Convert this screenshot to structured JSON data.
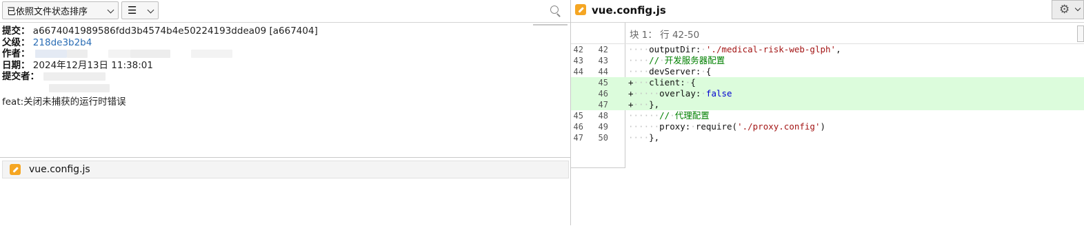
{
  "toolbar": {
    "sort_label": "已依照文件状态排序",
    "view_icon": "list-icon",
    "search_icon": "search-icon"
  },
  "commit": {
    "commit_label": "提交：",
    "commit_hash": "a6674041989586fdd3b4574b4e50224193ddea09 [a667404]",
    "parent_label": "父级：",
    "parent_hash": "218de3b2b4",
    "author_label": "作者：",
    "date_label": "日期：",
    "date_value": "2024年12月13日 11:38:01",
    "committer_label": "提交者：",
    "message": "feat:关闭未捕获的运行时错误"
  },
  "files": [
    {
      "name": "vue.config.js",
      "status_icon": "pencil-icon"
    }
  ],
  "diff": {
    "file_name": "vue.config.js",
    "settings_icon": "gear-icon",
    "hunk_header": "块 1： 行 42-50",
    "lines": [
      {
        "old": "42",
        "new": "42",
        "type": "ctx",
        "ws": "····",
        "tokens": [
          {
            "t": "outputDir:",
            "c": "k"
          },
          {
            "t": "·",
            "c": "ws"
          },
          {
            "t": "'./medical-risk-web-glph'",
            "c": "s"
          },
          {
            "t": ",",
            "c": "k"
          }
        ]
      },
      {
        "old": "43",
        "new": "43",
        "type": "ctx",
        "ws": "····",
        "tokens": [
          {
            "t": "//",
            "c": "c"
          },
          {
            "t": "·",
            "c": "ws"
          },
          {
            "t": "开发服务器配置",
            "c": "c"
          }
        ]
      },
      {
        "old": "44",
        "new": "44",
        "type": "ctx",
        "ws": "····",
        "tokens": [
          {
            "t": "devServer:",
            "c": "k"
          },
          {
            "t": "·",
            "c": "ws"
          },
          {
            "t": "{",
            "c": "k"
          }
        ]
      },
      {
        "old": "",
        "new": "45",
        "type": "add",
        "ws": "····",
        "tokens": [
          {
            "t": "client:",
            "c": "k"
          },
          {
            "t": "·",
            "c": "ws"
          },
          {
            "t": "{",
            "c": "k"
          }
        ]
      },
      {
        "old": "",
        "new": "46",
        "type": "add",
        "ws": "······",
        "tokens": [
          {
            "t": "overlay:",
            "c": "k"
          },
          {
            "t": "·",
            "c": "ws"
          },
          {
            "t": "false",
            "c": "b"
          }
        ]
      },
      {
        "old": "",
        "new": "47",
        "type": "add",
        "ws": "····",
        "tokens": [
          {
            "t": "},",
            "c": "k"
          }
        ]
      },
      {
        "old": "45",
        "new": "48",
        "type": "ctx",
        "ws": "······",
        "tokens": [
          {
            "t": "//",
            "c": "c"
          },
          {
            "t": "·",
            "c": "ws"
          },
          {
            "t": "代理配置",
            "c": "c"
          }
        ]
      },
      {
        "old": "46",
        "new": "49",
        "type": "ctx",
        "ws": "······",
        "tokens": [
          {
            "t": "proxy:",
            "c": "k"
          },
          {
            "t": "·",
            "c": "ws"
          },
          {
            "t": "require(",
            "c": "k"
          },
          {
            "t": "'./proxy.config'",
            "c": "s"
          },
          {
            "t": ")",
            "c": "k"
          }
        ]
      },
      {
        "old": "47",
        "new": "50",
        "type": "ctx",
        "ws": "····",
        "tokens": [
          {
            "t": "},",
            "c": "k"
          }
        ]
      }
    ]
  },
  "colors": {
    "added_bg": "#dcfcdc",
    "file_icon": "#f5a623",
    "link": "#2a6db5",
    "string": "#a31515",
    "comment": "#008000",
    "keyword": "#0000d0"
  }
}
